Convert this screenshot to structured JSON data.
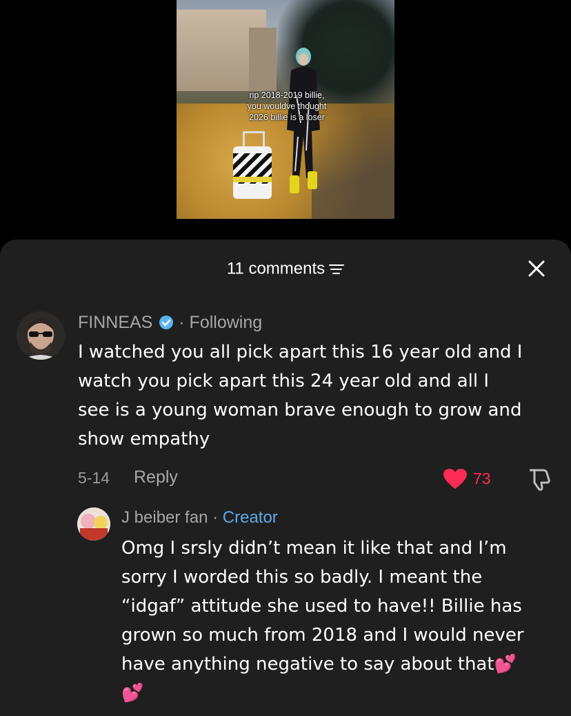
{
  "video": {
    "overlay_text": "rip 2018-2019 billie, you wouldve thought 2026 billie is a loser"
  },
  "sheet": {
    "comment_count_label": "11 comments",
    "sort_icon": "sort-lines-icon",
    "close_icon": "close-icon"
  },
  "comments": [
    {
      "author": "FINNEAS",
      "verified_icon": "verified-check-icon",
      "separator": "·",
      "relationship": "Following",
      "text_lines": [
        "I watched you all pick apart this 16 year old and I",
        "watch you pick apart this 24 year old and all I",
        "see is a young woman brave enough to grow and",
        "show empathy"
      ],
      "date": "5-14",
      "reply_label": "Reply",
      "likes": "73",
      "like_icon": "heart-icon",
      "dislike_icon": "thumbs-down-icon",
      "colors": {
        "like": "#fe2c55"
      }
    }
  ],
  "replies": [
    {
      "author": "J beiber fan",
      "separator": "·",
      "badge": "Creator",
      "text_lines": [
        "Omg I srsly didn’t mean it like that and I’m",
        "sorry I worded this so badly. I meant the",
        "“idgaf” attitude she used to have!! Billie has",
        "grown so much from 2018 and I would never",
        "have anything negative to say about that💕",
        "💕"
      ],
      "colors": {
        "badge": "#5fa8e8"
      }
    }
  ]
}
